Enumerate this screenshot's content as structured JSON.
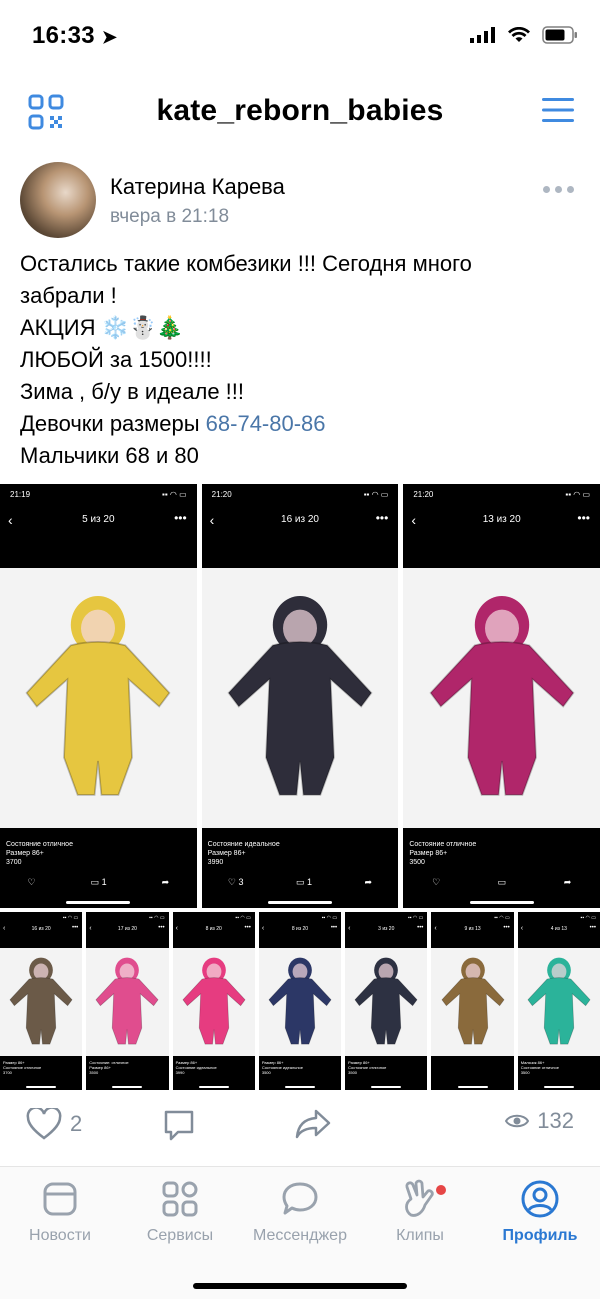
{
  "status": {
    "time": "16:33"
  },
  "header": {
    "title": "kate_reborn_babies",
    "qr_icon": "qr-code-icon",
    "menu_icon": "hamburger-menu-icon"
  },
  "post": {
    "author": "Катерина Карева",
    "time": "вчера в 21:18",
    "lines": {
      "l1": "Остались такие комбезики !!! Сегодня много",
      "l2": "забрали !",
      "l3": "АКЦИЯ ❄️☃️🎄",
      "l4": "ЛЮБОЙ за 1500!!!!",
      "l5": "Зима , б/у в идеале !!!",
      "l6_prefix": "Девочки размеры ",
      "l6_link": "68-74-80-86",
      "l7": "Мальчики 68 и 80"
    }
  },
  "big_shots": [
    {
      "clock": "21:19",
      "counter": "5 из 20",
      "cap1": "Состояние отличное",
      "cap2": "Размер 86+",
      "cap3": "3700",
      "likes": "",
      "comments": "1",
      "color": "#e6c640"
    },
    {
      "clock": "21:20",
      "counter": "16 из 20",
      "cap1": "Состояние идеальное",
      "cap2": "Размер 86+",
      "cap3": "3990",
      "likes": "3",
      "comments": "1",
      "color": "#2e2d3a"
    },
    {
      "clock": "21:20",
      "counter": "13 из 20",
      "cap1": "Состояние отличное",
      "cap2": "Размер 86+",
      "cap3": "3500",
      "likes": "",
      "comments": "",
      "color": "#b0266a"
    }
  ],
  "small_shots": [
    {
      "color": "#6b5a48",
      "counter": "16 из 20",
      "cap1": "Размер 86+",
      "cap2": "Состояние отличное",
      "cap3": "3700"
    },
    {
      "color": "#e04d8e",
      "counter": "17 из 20",
      "cap1": "Состояние: отличное",
      "cap2": "Размер 86+",
      "cap3": "3500"
    },
    {
      "color": "#e63c80",
      "counter": "8 из 20",
      "cap1": "Размер 86+",
      "cap2": "Состояние идеальное",
      "cap3": "3990"
    },
    {
      "color": "#2c3766",
      "counter": "8 из 20",
      "cap1": "Размер 86+",
      "cap2": "Состояние идеальное",
      "cap3": "3500"
    },
    {
      "color": "#2d3142",
      "counter": "3 из 20",
      "cap1": "Размер 86+",
      "cap2": "Состояние отличное",
      "cap3": "3500"
    },
    {
      "color": "#8a6a3c",
      "counter": "9 из 13",
      "cap1": "",
      "cap2": "",
      "cap3": ""
    },
    {
      "color": "#2bb39a",
      "counter": "4 из 13",
      "cap1": "Мальчик 86+",
      "cap2": "Состояние отличное",
      "cap3": "3500"
    }
  ],
  "actions": {
    "likes": "2",
    "views": "132"
  },
  "tabs": {
    "news": "Новости",
    "services": "Сервисы",
    "messenger": "Мессенджер",
    "clips": "Клипы",
    "profile": "Профиль"
  },
  "colors": {
    "accent": "#2a78d2",
    "link": "#4a76a8",
    "muted": "#818c99",
    "badge": "#e64646"
  }
}
